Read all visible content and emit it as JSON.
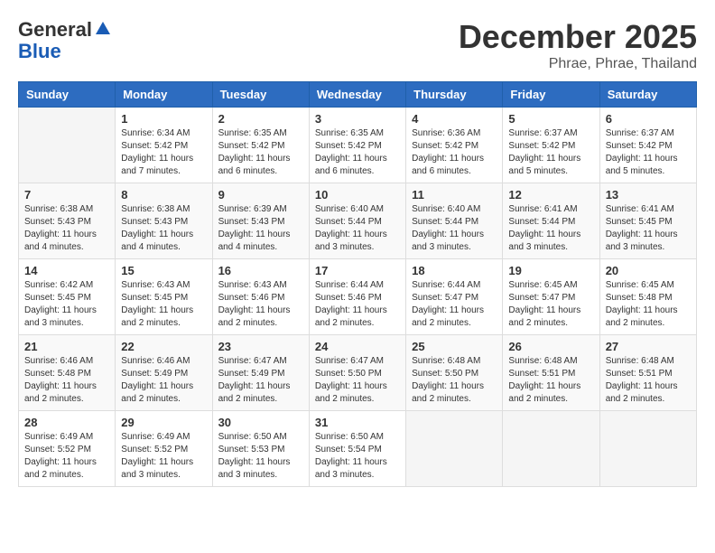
{
  "header": {
    "logo_general": "General",
    "logo_blue": "Blue",
    "month_year": "December 2025",
    "location": "Phrae, Phrae, Thailand"
  },
  "weekdays": [
    "Sunday",
    "Monday",
    "Tuesday",
    "Wednesday",
    "Thursday",
    "Friday",
    "Saturday"
  ],
  "weeks": [
    [
      {
        "day": "",
        "info": ""
      },
      {
        "day": "1",
        "info": "Sunrise: 6:34 AM\nSunset: 5:42 PM\nDaylight: 11 hours\nand 7 minutes."
      },
      {
        "day": "2",
        "info": "Sunrise: 6:35 AM\nSunset: 5:42 PM\nDaylight: 11 hours\nand 6 minutes."
      },
      {
        "day": "3",
        "info": "Sunrise: 6:35 AM\nSunset: 5:42 PM\nDaylight: 11 hours\nand 6 minutes."
      },
      {
        "day": "4",
        "info": "Sunrise: 6:36 AM\nSunset: 5:42 PM\nDaylight: 11 hours\nand 6 minutes."
      },
      {
        "day": "5",
        "info": "Sunrise: 6:37 AM\nSunset: 5:42 PM\nDaylight: 11 hours\nand 5 minutes."
      },
      {
        "day": "6",
        "info": "Sunrise: 6:37 AM\nSunset: 5:42 PM\nDaylight: 11 hours\nand 5 minutes."
      }
    ],
    [
      {
        "day": "7",
        "info": "Sunrise: 6:38 AM\nSunset: 5:43 PM\nDaylight: 11 hours\nand 4 minutes."
      },
      {
        "day": "8",
        "info": "Sunrise: 6:38 AM\nSunset: 5:43 PM\nDaylight: 11 hours\nand 4 minutes."
      },
      {
        "day": "9",
        "info": "Sunrise: 6:39 AM\nSunset: 5:43 PM\nDaylight: 11 hours\nand 4 minutes."
      },
      {
        "day": "10",
        "info": "Sunrise: 6:40 AM\nSunset: 5:44 PM\nDaylight: 11 hours\nand 3 minutes."
      },
      {
        "day": "11",
        "info": "Sunrise: 6:40 AM\nSunset: 5:44 PM\nDaylight: 11 hours\nand 3 minutes."
      },
      {
        "day": "12",
        "info": "Sunrise: 6:41 AM\nSunset: 5:44 PM\nDaylight: 11 hours\nand 3 minutes."
      },
      {
        "day": "13",
        "info": "Sunrise: 6:41 AM\nSunset: 5:45 PM\nDaylight: 11 hours\nand 3 minutes."
      }
    ],
    [
      {
        "day": "14",
        "info": "Sunrise: 6:42 AM\nSunset: 5:45 PM\nDaylight: 11 hours\nand 3 minutes."
      },
      {
        "day": "15",
        "info": "Sunrise: 6:43 AM\nSunset: 5:45 PM\nDaylight: 11 hours\nand 2 minutes."
      },
      {
        "day": "16",
        "info": "Sunrise: 6:43 AM\nSunset: 5:46 PM\nDaylight: 11 hours\nand 2 minutes."
      },
      {
        "day": "17",
        "info": "Sunrise: 6:44 AM\nSunset: 5:46 PM\nDaylight: 11 hours\nand 2 minutes."
      },
      {
        "day": "18",
        "info": "Sunrise: 6:44 AM\nSunset: 5:47 PM\nDaylight: 11 hours\nand 2 minutes."
      },
      {
        "day": "19",
        "info": "Sunrise: 6:45 AM\nSunset: 5:47 PM\nDaylight: 11 hours\nand 2 minutes."
      },
      {
        "day": "20",
        "info": "Sunrise: 6:45 AM\nSunset: 5:48 PM\nDaylight: 11 hours\nand 2 minutes."
      }
    ],
    [
      {
        "day": "21",
        "info": "Sunrise: 6:46 AM\nSunset: 5:48 PM\nDaylight: 11 hours\nand 2 minutes."
      },
      {
        "day": "22",
        "info": "Sunrise: 6:46 AM\nSunset: 5:49 PM\nDaylight: 11 hours\nand 2 minutes."
      },
      {
        "day": "23",
        "info": "Sunrise: 6:47 AM\nSunset: 5:49 PM\nDaylight: 11 hours\nand 2 minutes."
      },
      {
        "day": "24",
        "info": "Sunrise: 6:47 AM\nSunset: 5:50 PM\nDaylight: 11 hours\nand 2 minutes."
      },
      {
        "day": "25",
        "info": "Sunrise: 6:48 AM\nSunset: 5:50 PM\nDaylight: 11 hours\nand 2 minutes."
      },
      {
        "day": "26",
        "info": "Sunrise: 6:48 AM\nSunset: 5:51 PM\nDaylight: 11 hours\nand 2 minutes."
      },
      {
        "day": "27",
        "info": "Sunrise: 6:48 AM\nSunset: 5:51 PM\nDaylight: 11 hours\nand 2 minutes."
      }
    ],
    [
      {
        "day": "28",
        "info": "Sunrise: 6:49 AM\nSunset: 5:52 PM\nDaylight: 11 hours\nand 2 minutes."
      },
      {
        "day": "29",
        "info": "Sunrise: 6:49 AM\nSunset: 5:52 PM\nDaylight: 11 hours\nand 3 minutes."
      },
      {
        "day": "30",
        "info": "Sunrise: 6:50 AM\nSunset: 5:53 PM\nDaylight: 11 hours\nand 3 minutes."
      },
      {
        "day": "31",
        "info": "Sunrise: 6:50 AM\nSunset: 5:54 PM\nDaylight: 11 hours\nand 3 minutes."
      },
      {
        "day": "",
        "info": ""
      },
      {
        "day": "",
        "info": ""
      },
      {
        "day": "",
        "info": ""
      }
    ]
  ]
}
